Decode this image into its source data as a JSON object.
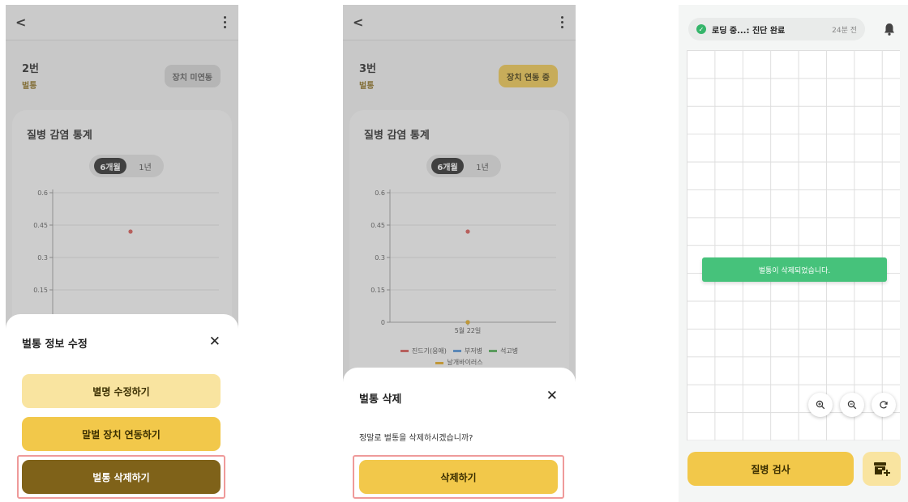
{
  "screens": [
    {
      "hive_name": "2번",
      "hive_sub": "벌통",
      "device_label": "장치 미연동",
      "stats_title": "질병 감염 통계",
      "period_active": "6개월",
      "period_inactive": "1년",
      "sheet": {
        "title": "벌통 정보 수정",
        "buttons": [
          "별명 수정하기",
          "말벌 장치 연동하기",
          "벌통 삭제하기"
        ]
      }
    },
    {
      "hive_name": "3번",
      "hive_sub": "벌통",
      "device_label": "장치 연동 중",
      "stats_title": "질병 감염 통계",
      "period_active": "6개월",
      "period_inactive": "1년",
      "sheet": {
        "title": "벌통 삭제",
        "message": "정말로 벌통을 삭제하시겠습니까?",
        "confirm": "삭제하기"
      }
    },
    {
      "status_text": "로딩 중...: 진단 완료",
      "status_time": "24분 전",
      "toast": "벌통이 삭제되었습니다.",
      "exam_button": "질병 검사"
    }
  ],
  "chart_data": {
    "type": "scatter",
    "ylim": [
      0,
      0.6
    ],
    "yticks": [
      "0",
      "0.15",
      "0.3",
      "0.45",
      "0.6"
    ],
    "categories": [
      "5월 22일"
    ],
    "series": [
      {
        "name": "진드기(응애)",
        "color": "#d9534f",
        "values": [
          0.42
        ]
      },
      {
        "name": "부저병",
        "color": "#4a90d9",
        "values": [
          0
        ]
      },
      {
        "name": "석고병",
        "color": "#4caf50",
        "values": [
          0
        ]
      },
      {
        "name": "날개바이러스",
        "color": "#e6a817",
        "values": [
          0
        ]
      }
    ]
  },
  "colors": {
    "accent_yellow": "#f2c84a",
    "light_yellow": "#f9e4a0",
    "brown": "#7f6219",
    "success_green": "#46c27b",
    "highlight_red": "#ef9a9a"
  }
}
